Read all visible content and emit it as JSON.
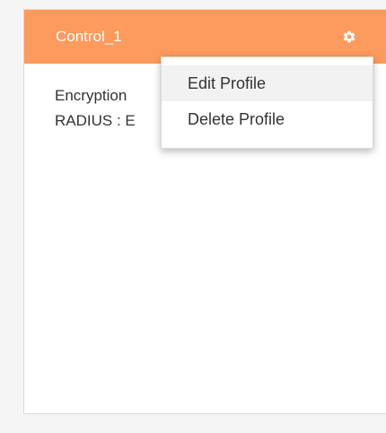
{
  "card": {
    "title": "Control_1",
    "lines": [
      "Encryption",
      "RADIUS : E"
    ]
  },
  "menu": {
    "items": [
      {
        "label": "Edit Profile"
      },
      {
        "label": "Delete Profile"
      }
    ]
  },
  "icons": {
    "settings": "gear-icon"
  },
  "colors": {
    "header": "#fd9a5e",
    "text": "#333333",
    "menu_hover": "#f2f2f2"
  }
}
